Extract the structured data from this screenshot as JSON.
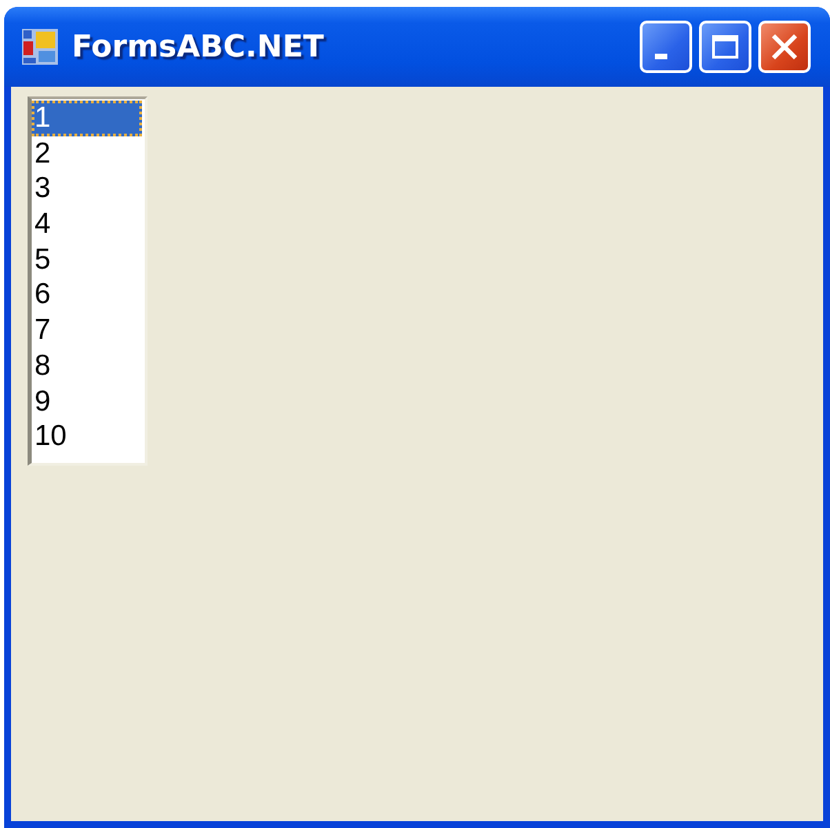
{
  "window": {
    "title": "FormsABC.NET"
  },
  "listbox": {
    "items": [
      {
        "label": "1",
        "selected": true
      },
      {
        "label": "2",
        "selected": false
      },
      {
        "label": "3",
        "selected": false
      },
      {
        "label": "4",
        "selected": false
      },
      {
        "label": "5",
        "selected": false
      },
      {
        "label": "6",
        "selected": false
      },
      {
        "label": "7",
        "selected": false
      },
      {
        "label": "8",
        "selected": false
      },
      {
        "label": "9",
        "selected": false
      },
      {
        "label": "10",
        "selected": false
      }
    ]
  }
}
